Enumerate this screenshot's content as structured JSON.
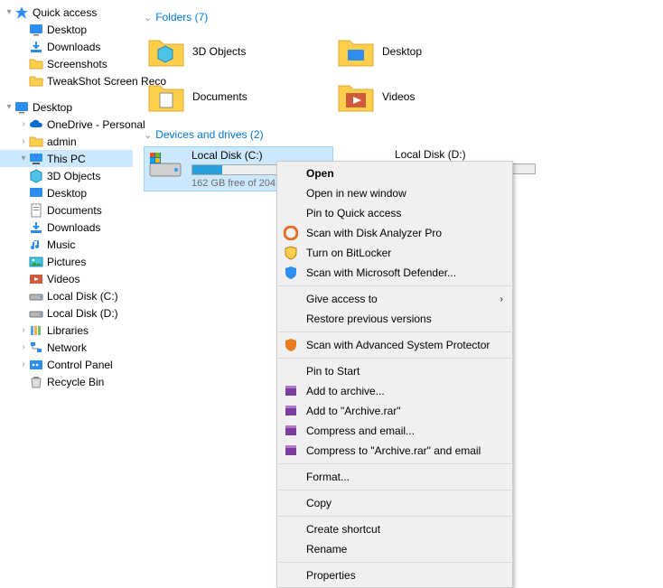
{
  "tree": {
    "quick_access": "Quick access",
    "qa_items": [
      "Desktop",
      "Downloads",
      "Screenshots",
      "TweakShot Screen Reco"
    ],
    "desktop": "Desktop",
    "onedrive": "OneDrive - Personal",
    "admin": "admin",
    "this_pc": "This PC",
    "pc_items": [
      "3D Objects",
      "Desktop",
      "Documents",
      "Downloads",
      "Music",
      "Pictures",
      "Videos",
      "Local Disk (C:)",
      "Local Disk (D:)"
    ],
    "libraries": "Libraries",
    "network": "Network",
    "control_panel": "Control Panel",
    "recycle_bin": "Recycle Bin"
  },
  "folders": {
    "header": "Folders (7)",
    "items": [
      "3D Objects",
      "Desktop",
      "Documents",
      "Videos"
    ]
  },
  "drives": {
    "header": "Devices and drives (2)",
    "c": {
      "name": "Local Disk (C:)",
      "free": "162 GB free of 204 GB",
      "fill": 22
    },
    "d": {
      "name": "Local Disk (D:)",
      "fill": 17
    }
  },
  "menu": {
    "open": "Open",
    "open_new": "Open in new window",
    "pin_qa": "Pin to Quick access",
    "scan_dap": "Scan with Disk Analyzer Pro",
    "bitlocker": "Turn on BitLocker",
    "defender": "Scan with Microsoft Defender...",
    "give_access": "Give access to",
    "restore_prev": "Restore previous versions",
    "asp": "Scan with Advanced System Protector",
    "pin_start": "Pin to Start",
    "add_archive": "Add to archive...",
    "add_archive_rar": "Add to \"Archive.rar\"",
    "compress_email": "Compress and email...",
    "compress_email_rar": "Compress to \"Archive.rar\" and email",
    "format": "Format...",
    "copy": "Copy",
    "shortcut": "Create shortcut",
    "rename": "Rename",
    "properties": "Properties"
  }
}
